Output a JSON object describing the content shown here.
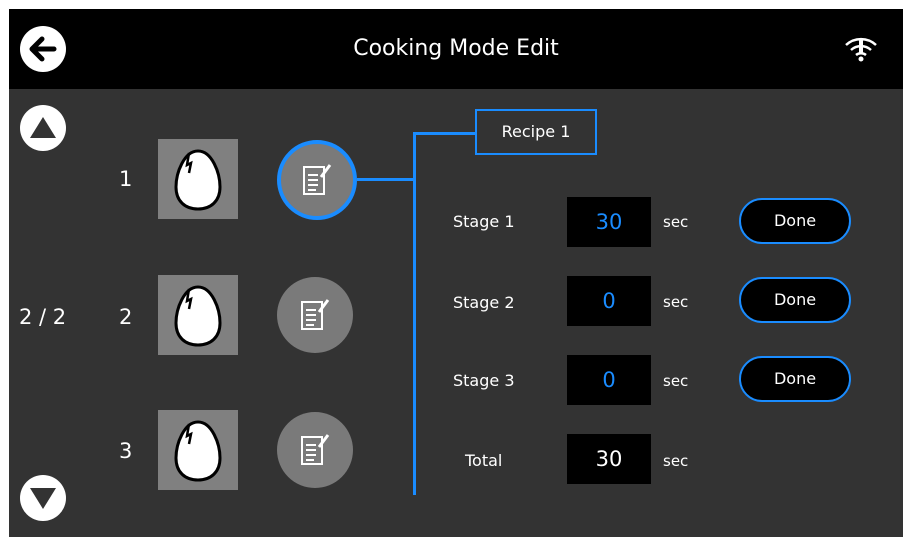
{
  "header": {
    "title": "Cooking Mode Edit"
  },
  "icons": {
    "back": "back-arrow-icon",
    "wifi": "wifi-alert-icon",
    "up": "up-arrow-icon",
    "down": "down-arrow-icon",
    "egg": "egg-icon",
    "recipe": "recipe-edit-icon"
  },
  "pager": {
    "indicator": "2 / 2"
  },
  "rows": [
    {
      "number": "1",
      "selected": true
    },
    {
      "number": "2",
      "selected": false
    },
    {
      "number": "3",
      "selected": false
    }
  ],
  "recipe": {
    "label": "Recipe 1"
  },
  "stages": [
    {
      "label": "Stage 1",
      "value": "30",
      "unit": "sec",
      "button": "Done"
    },
    {
      "label": "Stage 2",
      "value": "0",
      "unit": "sec",
      "button": "Done"
    },
    {
      "label": "Stage 3",
      "value": "0",
      "unit": "sec",
      "button": "Done"
    }
  ],
  "total": {
    "label": "Total",
    "value": "30",
    "unit": "sec"
  },
  "colors": {
    "accent": "#1a8cff",
    "background": "#333333",
    "header": "#000000",
    "tile": "#808080"
  }
}
